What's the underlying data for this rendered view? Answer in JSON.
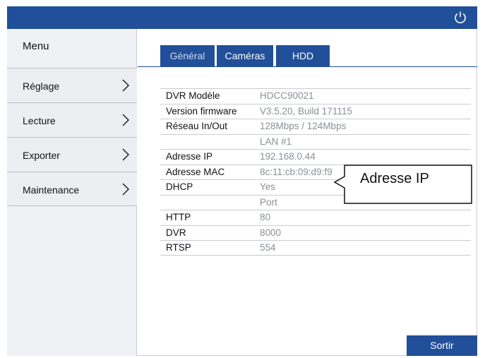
{
  "sidebar": {
    "title": "Menu",
    "items": [
      {
        "label": "Réglage"
      },
      {
        "label": "Lecture"
      },
      {
        "label": "Exporter"
      },
      {
        "label": "Maintenance"
      }
    ]
  },
  "tabs": [
    {
      "label": "Général"
    },
    {
      "label": "Caméras"
    },
    {
      "label": "HDD"
    }
  ],
  "info_rows": [
    {
      "key": "DVR Modèle",
      "value": "HDCC90021"
    },
    {
      "key": "Version firmware",
      "value": "V3.5.20, Build 171115"
    },
    {
      "key": "Réseau In/Out",
      "value": "128Mbps / 124Mbps"
    },
    {
      "key": "",
      "value": "LAN #1"
    },
    {
      "key": "Adresse IP",
      "value": "192.168.0.44"
    },
    {
      "key": "Adresse MAC",
      "value": "8c:11:cb:09:d9:f9"
    },
    {
      "key": "DHCP",
      "value": "Yes"
    },
    {
      "key": "",
      "value": "Port"
    },
    {
      "key": "HTTP",
      "value": "80"
    },
    {
      "key": "DVR",
      "value": "8000"
    },
    {
      "key": "RTSP",
      "value": "554"
    }
  ],
  "callout": {
    "text": "Adresse IP"
  },
  "buttons": {
    "exit_label": "Sortir"
  },
  "icons": {
    "power": "power-icon",
    "chevron": "chevron-right-icon"
  },
  "colors": {
    "accent": "#214f99",
    "sidebar_bg": "#eceef2"
  }
}
